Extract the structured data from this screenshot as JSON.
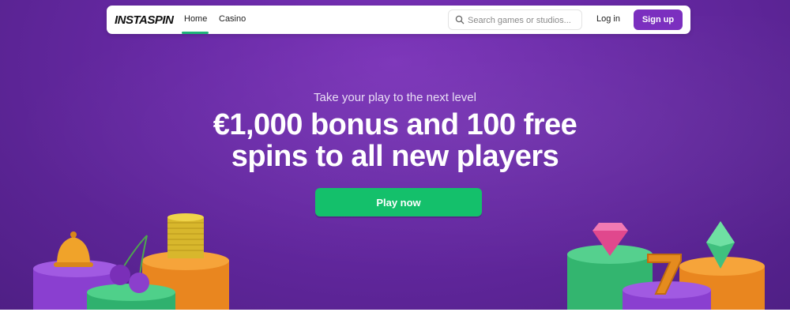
{
  "nav": {
    "logo": "INSTASPIN",
    "links": [
      {
        "label": "Home"
      },
      {
        "label": "Casino"
      }
    ],
    "search_placeholder": "Search games or studios...",
    "login_label": "Log in",
    "signup_label": "Sign up"
  },
  "hero": {
    "tagline": "Take your play to the next level",
    "headline": "€1,000 bonus and 100 free spins to all new players",
    "cta_label": "Play now"
  },
  "colors": {
    "brand_purple": "#7b2fbf",
    "cta_green": "#14c06b",
    "active_underline": "#1fb578"
  },
  "icons": [
    "search-icon",
    "bell-icon",
    "cherries-icon",
    "coin-stack-icon",
    "diamond-icon",
    "seven-icon",
    "green-gem-icon"
  ]
}
